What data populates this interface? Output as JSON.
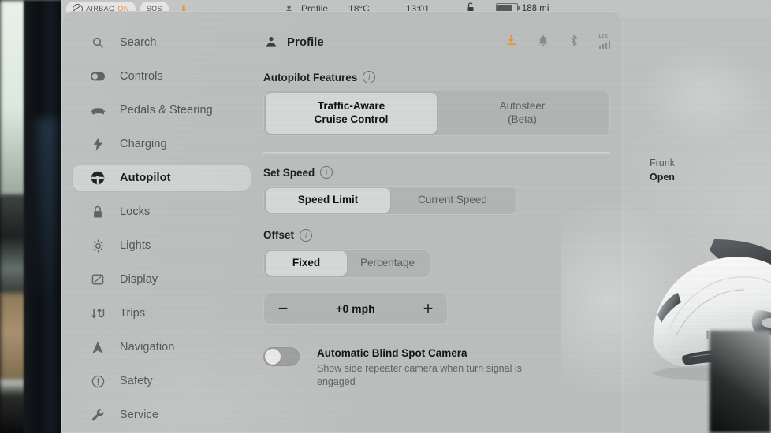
{
  "statusbar": {
    "airbag_label": "AIRBAG",
    "airbag_state": "ON",
    "sos_label": "SOS",
    "profile_label": "Profile",
    "temperature": "18°C",
    "time": "13:01",
    "lock_icon": "unlocked-padlock-icon",
    "battery_range": "188 mi"
  },
  "sidebar": {
    "items": [
      {
        "label": "Search",
        "icon": "search-icon",
        "active": false
      },
      {
        "label": "Controls",
        "icon": "toggle-switch-icon",
        "active": false
      },
      {
        "label": "Pedals & Steering",
        "icon": "car-front-icon",
        "active": false
      },
      {
        "label": "Charging",
        "icon": "lightning-bolt-icon",
        "active": false
      },
      {
        "label": "Autopilot",
        "icon": "steering-wheel-icon",
        "active": true
      },
      {
        "label": "Locks",
        "icon": "padlock-icon",
        "active": false
      },
      {
        "label": "Lights",
        "icon": "sun-brightness-icon",
        "active": false
      },
      {
        "label": "Display",
        "icon": "display-screen-icon",
        "active": false
      },
      {
        "label": "Trips",
        "icon": "trips-arrows-icon",
        "active": false
      },
      {
        "label": "Navigation",
        "icon": "navigation-arrow-icon",
        "active": false
      },
      {
        "label": "Safety",
        "icon": "exclamation-circle-icon",
        "active": false
      },
      {
        "label": "Service",
        "icon": "wrench-icon",
        "active": false
      }
    ]
  },
  "pane": {
    "title": "Profile",
    "title_icon": "person-icon",
    "status_icons": [
      {
        "name": "software-update-download-icon",
        "glyph": "⬇",
        "color": "#e8912a"
      },
      {
        "name": "notification-bell-icon",
        "glyph": "🔔",
        "color": "#8a8c8c"
      },
      {
        "name": "bluetooth-icon",
        "glyph": "ᛦ",
        "color": "#8a8c8c"
      },
      {
        "name": "lte-signal-icon",
        "glyph": "LTE",
        "color": "#8a8c8c"
      }
    ],
    "sections": [
      {
        "key": "autopilot_features",
        "title": "Autopilot Features",
        "info_icon": "info-icon",
        "options": [
          {
            "label": "Traffic-Aware\nCruise Control",
            "line1": "Traffic-Aware",
            "line2": "Cruise Control",
            "selected": true
          },
          {
            "label": "Autosteer\n(Beta)",
            "line1": "Autosteer",
            "line2": "(Beta)",
            "selected": false
          }
        ]
      },
      {
        "key": "set_speed",
        "title": "Set Speed",
        "info_icon": "info-icon",
        "options": [
          {
            "line1": "Speed Limit",
            "line2": "",
            "selected": true
          },
          {
            "line1": "Current Speed",
            "line2": "",
            "selected": false
          }
        ]
      },
      {
        "key": "offset",
        "title": "Offset",
        "info_icon": "info-icon",
        "options": [
          {
            "line1": "Fixed",
            "line2": "",
            "selected": true
          },
          {
            "line1": "Percentage",
            "line2": "",
            "selected": false
          }
        ]
      }
    ],
    "stepper": {
      "decrement_label": "−",
      "value": "+0 mph",
      "increment_label": "+"
    },
    "toggle_setting": {
      "title": "Automatic Blind Spot Camera",
      "subtitle": "Show side repeater camera when turn signal is engaged",
      "state": "off"
    }
  },
  "car_panel": {
    "frunk_label": "Frunk",
    "frunk_state": "Open",
    "vehicle": "tesla-model-3-front-view"
  },
  "colors": {
    "screen_bg": "#b9bbbb",
    "card_bg": "#bcbebe",
    "selected_segment": "#d6d8d7",
    "segment_track": "#b3b5b5",
    "accent_orange": "#e8912a",
    "text_primary": "#131415",
    "text_secondary": "#5a5c5d"
  }
}
